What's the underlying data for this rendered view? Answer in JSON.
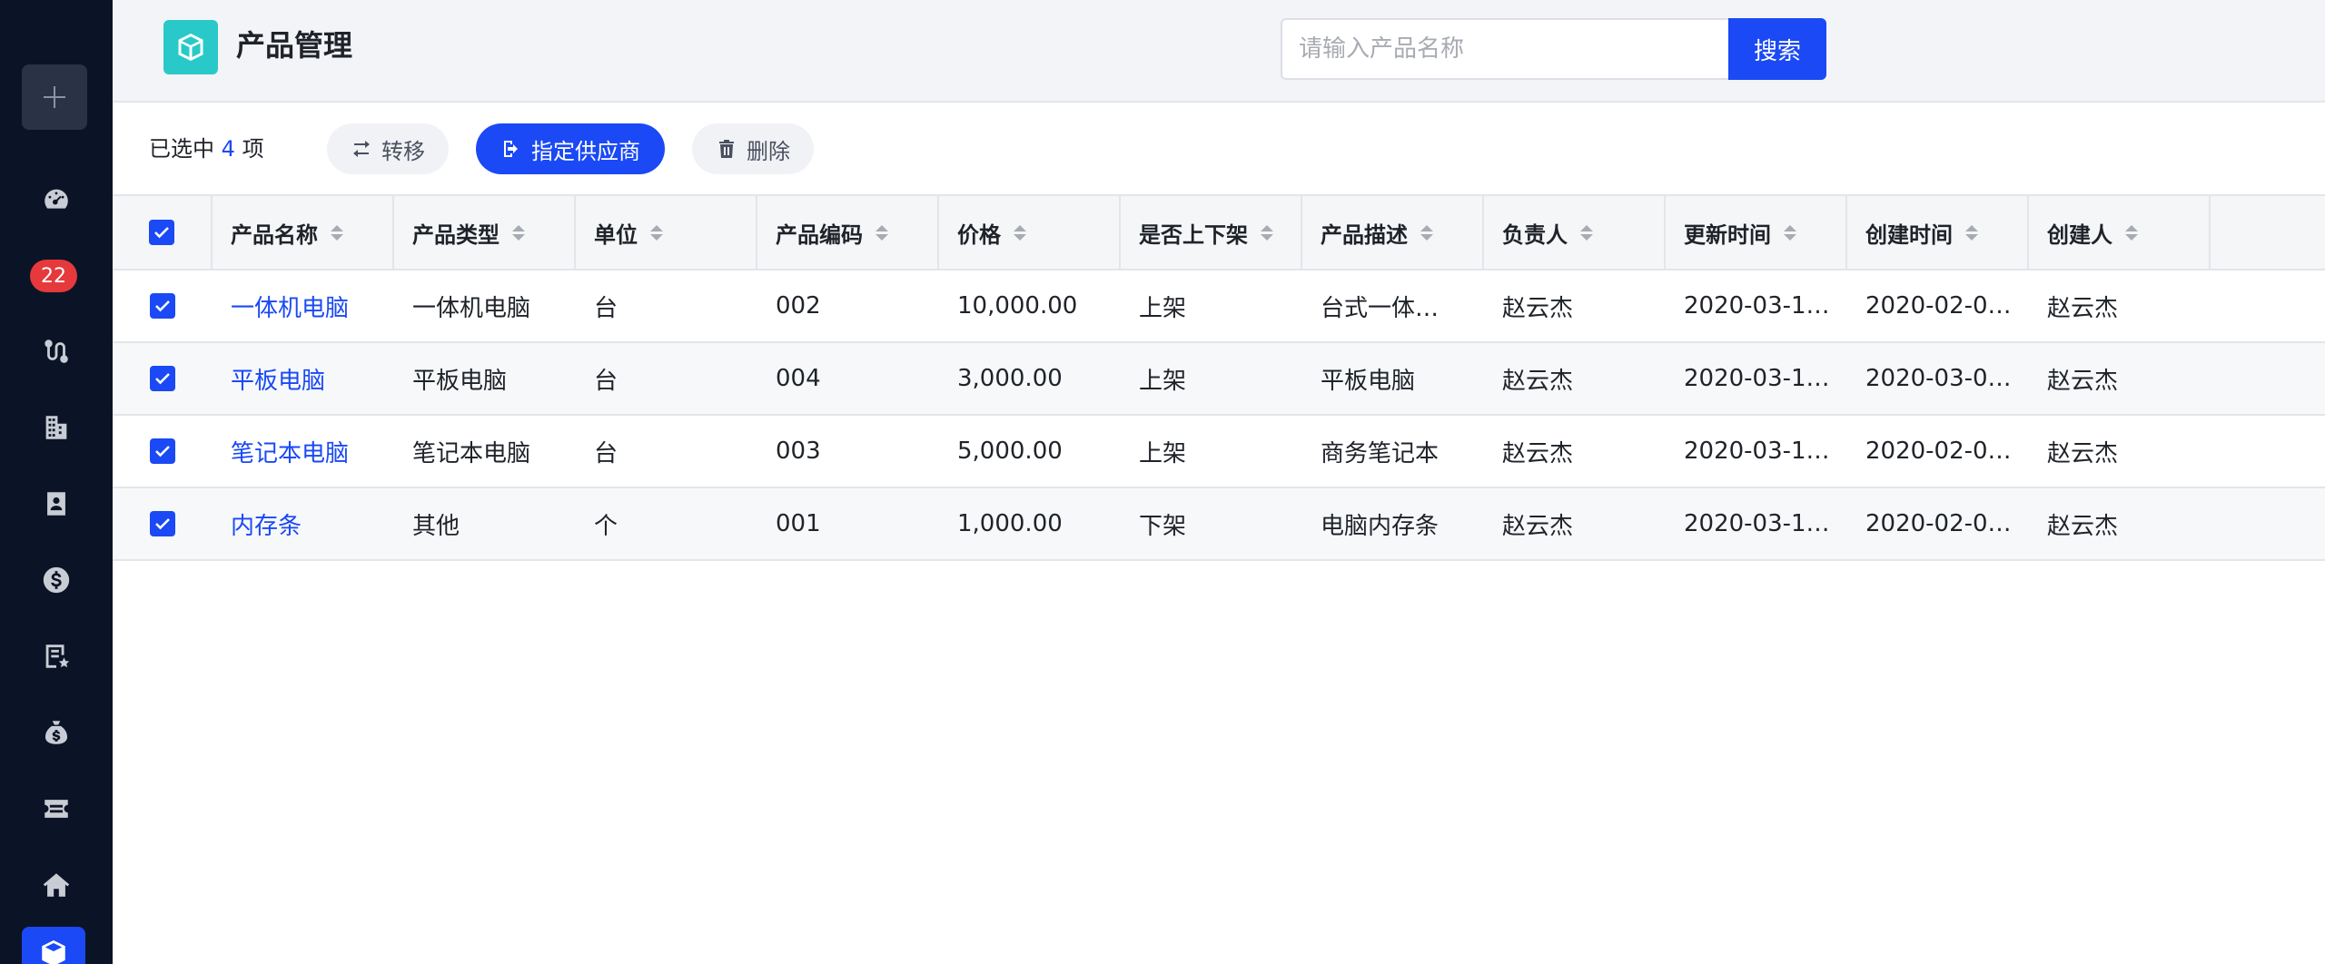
{
  "sidebar": {
    "badge": "22",
    "items": [
      {
        "icon": "dashboard-icon"
      },
      {
        "icon": "workflow-icon"
      },
      {
        "icon": "building-icon"
      },
      {
        "icon": "contacts-icon"
      },
      {
        "icon": "dollar-icon"
      },
      {
        "icon": "report-star-icon"
      },
      {
        "icon": "money-bag-icon"
      },
      {
        "icon": "ticket-icon"
      },
      {
        "icon": "home-icon"
      },
      {
        "icon": "product-cube-icon"
      }
    ]
  },
  "header": {
    "title": "产品管理",
    "search_placeholder": "请输入产品名称",
    "search_label": "搜索"
  },
  "toolbar": {
    "selected_prefix": "已选中",
    "selected_count": "4",
    "selected_suffix": "项",
    "transfer_label": "转移",
    "assign_label": "指定供应商",
    "delete_label": "删除"
  },
  "table": {
    "columns": [
      "产品名称",
      "产品类型",
      "单位",
      "产品编码",
      "价格",
      "是否上下架",
      "产品描述",
      "负责人",
      "更新时间",
      "创建时间",
      "创建人"
    ],
    "rows": [
      [
        "一体机电脑",
        "一体机电脑",
        "台",
        "002",
        "10,000.00",
        "上架",
        "台式一体…",
        "赵云杰",
        "2020-03-1…",
        "2020-02-0…",
        "赵云杰"
      ],
      [
        "平板电脑",
        "平板电脑",
        "台",
        "004",
        "3,000.00",
        "上架",
        "平板电脑",
        "赵云杰",
        "2020-03-1…",
        "2020-03-0…",
        "赵云杰"
      ],
      [
        "笔记本电脑",
        "笔记本电脑",
        "台",
        "003",
        "5,000.00",
        "上架",
        "商务笔记本",
        "赵云杰",
        "2020-03-1…",
        "2020-02-0…",
        "赵云杰"
      ],
      [
        "内存条",
        "其他",
        "个",
        "001",
        "1,000.00",
        "下架",
        "电脑内存条",
        "赵云杰",
        "2020-03-1…",
        "2020-02-0…",
        "赵云杰"
      ]
    ]
  },
  "colors": {
    "primary": "#1a49f5",
    "sidebar_bg": "#0b1426",
    "logo_bg": "#2ac9c9",
    "badge": "#e5393c"
  }
}
